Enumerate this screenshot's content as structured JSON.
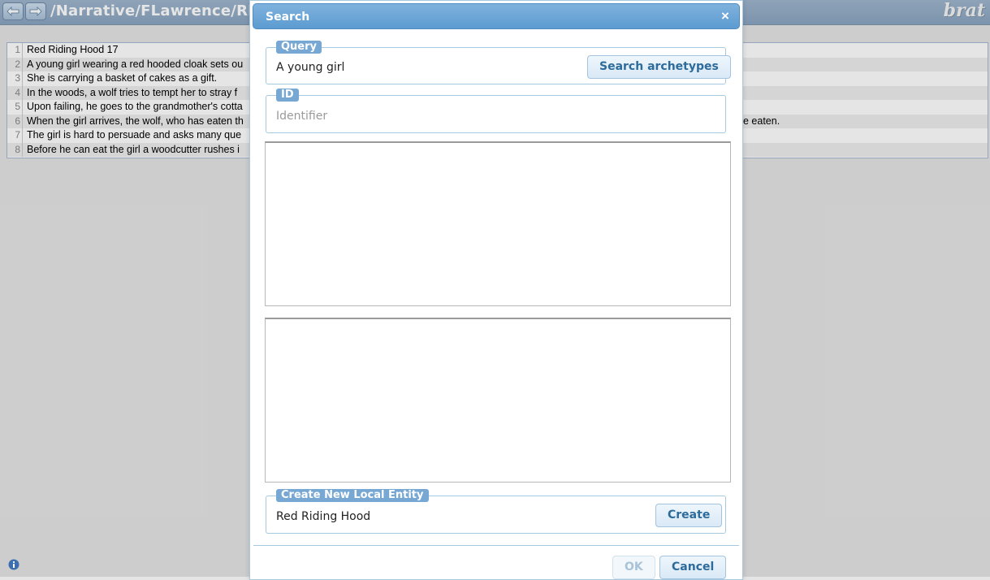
{
  "header": {
    "back_icon": "arrow-left-icon",
    "forward_icon": "arrow-right-icon",
    "path": "/Narrative/FLawrence/RRHS",
    "logo": "brat"
  },
  "document": {
    "lines": [
      {
        "num": "1",
        "text": "Red Riding Hood 17"
      },
      {
        "num": "2",
        "text": "A young girl wearing a red hooded cloak sets ou"
      },
      {
        "num": "3",
        "text": "She is carrying a basket of cakes as a gift."
      },
      {
        "num": "4",
        "text": "In the woods, a wolf tries to tempt her to stray f"
      },
      {
        "num": "5",
        "text": "Upon failing, he goes to the grandmother's cotta"
      },
      {
        "num": "6",
        "text": "When the girl arrives, the wolf, who has eaten th",
        "tail": "e eaten."
      },
      {
        "num": "7",
        "text": "The girl is hard to persuade and asks many que"
      },
      {
        "num": "8",
        "text": "Before he can eat the girl a woodcutter rushes i"
      }
    ]
  },
  "dialog": {
    "title": "Search",
    "close": "×",
    "query": {
      "legend": "Query",
      "value": "A young girl",
      "button": "Search archetypes"
    },
    "id": {
      "legend": "ID",
      "placeholder": "Identifier"
    },
    "create": {
      "legend": "Create New Local Entity",
      "value": "Red Riding Hood",
      "button": "Create"
    },
    "ok_label": "OK",
    "cancel_label": "Cancel"
  },
  "info_icon": "info-icon",
  "colors": {
    "titlebar": "#5c9bd1",
    "legend": "#77a8d3",
    "button_text": "#2d6b9b",
    "header": "#8aa5c1"
  }
}
